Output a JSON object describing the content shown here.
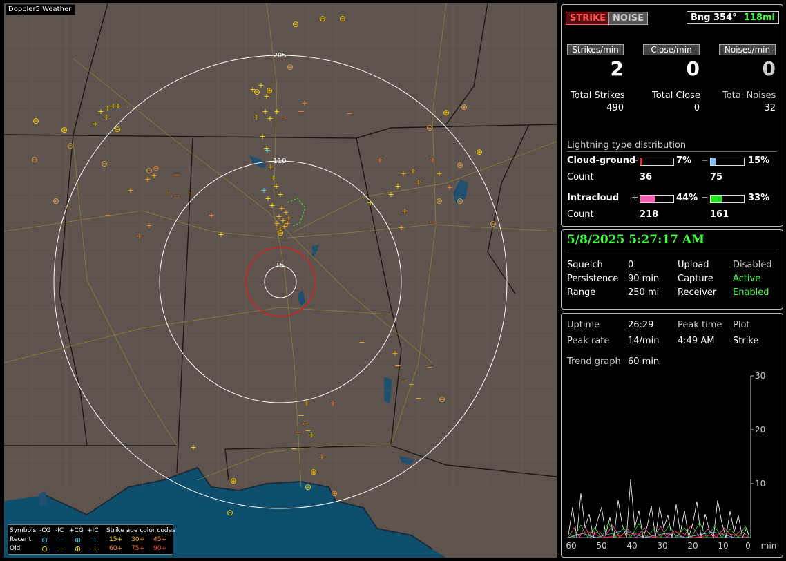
{
  "map": {
    "title": "Doppler5 Weather",
    "range_labels": [
      "205",
      "110",
      "15"
    ],
    "legend": {
      "symbols_label": "Symbols",
      "cols": [
        "-CG",
        "-IC",
        "+CG",
        "+IC"
      ],
      "recent_label": "Recent",
      "old_label": "Old",
      "age_title": "Strike age color codes",
      "age_recent": [
        "15+",
        "30+",
        "45+"
      ],
      "age_old": [
        "60+",
        "75+",
        "90+"
      ]
    }
  },
  "status": {
    "strike_button": "STRIKE",
    "noise_button": "NOISE",
    "bearing": "Bng 354°",
    "distance": "118mi",
    "strikes_per_min_label": "Strikes/min",
    "close_per_min_label": "Close/min",
    "noises_per_min_label": "Noises/min",
    "strikes_per_min": "2",
    "close_per_min": "0",
    "noises_per_min": "0",
    "total_strikes_label": "Total Strikes",
    "total_close_label": "Total Close",
    "total_noises_label": "Total Noises",
    "total_strikes": "490",
    "total_close": "0",
    "total_noises": "32"
  },
  "distribution": {
    "title": "Lightning type distribution",
    "cg_label": "Cloud-ground",
    "ic_label": "Intracloud",
    "plus": "+",
    "minus": "−",
    "count_label": "Count",
    "cg_pos_pct": "7%",
    "cg_neg_pct": "15%",
    "ic_pos_pct": "44%",
    "ic_neg_pct": "33%",
    "cg_pos_count": "36",
    "cg_neg_count": "75",
    "ic_pos_count": "218",
    "ic_neg_count": "161",
    "fill": {
      "cg_pos": 0.07,
      "cg_neg": 0.15,
      "ic_pos": 0.44,
      "ic_neg": 0.33
    },
    "colors": {
      "cg_pos": "#ff2020",
      "cg_neg": "#80c0ff",
      "ic_pos": "#ff60b0",
      "ic_neg": "#20e020"
    }
  },
  "settings": {
    "datetime": "5/8/2025 5:27:17 AM",
    "squelch_label": "Squelch",
    "squelch": "0",
    "persistence_label": "Persistence",
    "persistence": "90 min",
    "range_label": "Range",
    "range": "250 mi",
    "upload_label": "Upload",
    "upload": "Disabled",
    "capture_label": "Capture",
    "capture": "Active",
    "receiver_label": "Receiver",
    "receiver": "Enabled"
  },
  "stats": {
    "uptime_label": "Uptime",
    "uptime": "26:29",
    "peak_time_label": "Peak time",
    "peak_time": "4:49 AM",
    "plot_label": "Plot",
    "plot": "Strike",
    "peak_rate_label": "Peak rate",
    "peak_rate": "14/min",
    "trend_label": "Trend graph",
    "trend": "60 min",
    "y_ticks": [
      "30",
      "20",
      "10"
    ],
    "x_ticks": [
      "60",
      "50",
      "40",
      "30",
      "20",
      "10",
      "0"
    ],
    "x_unit": "min"
  }
}
